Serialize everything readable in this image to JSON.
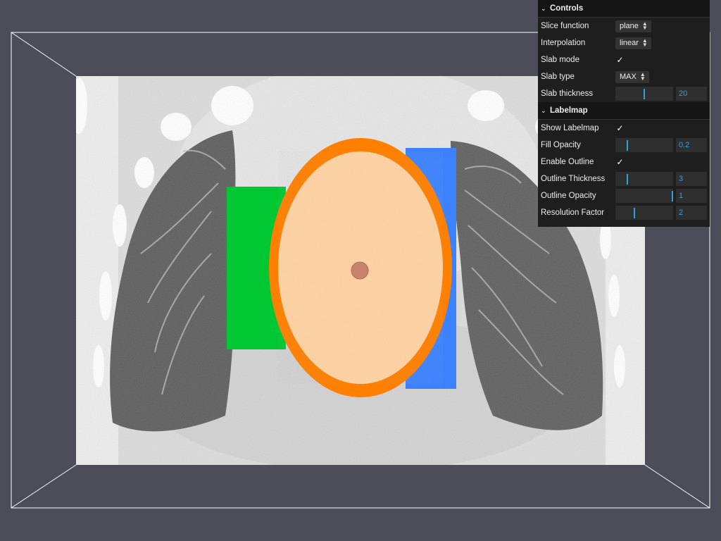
{
  "controls": {
    "title": "Controls",
    "slice_function": {
      "label": "Slice function",
      "value": "plane"
    },
    "interpolation": {
      "label": "Interpolation",
      "value": "linear"
    },
    "slab_mode": {
      "label": "Slab mode",
      "checked": true
    },
    "slab_type": {
      "label": "Slab type",
      "value": "MAX"
    },
    "slab_thickness": {
      "label": "Slab thickness",
      "value": "20",
      "fraction": 0.5
    }
  },
  "labelmap": {
    "title": "Labelmap",
    "show_labelmap": {
      "label": "Show Labelmap",
      "checked": true
    },
    "fill_opacity": {
      "label": "Fill Opacity",
      "value": "0.2",
      "fraction": 0.2
    },
    "enable_outline": {
      "label": "Enable Outline",
      "checked": true
    },
    "outline_thickness": {
      "label": "Outline Thickness",
      "value": "3",
      "fraction": 0.2
    },
    "outline_opacity": {
      "label": "Outline Opacity",
      "value": "1",
      "fraction": 1.0
    },
    "resolution_factor": {
      "label": "Resolution Factor",
      "value": "2",
      "fraction": 0.33
    }
  },
  "icons": {
    "chevron": "chevron-down-icon",
    "check": "checkmark-icon",
    "select_arrows": "up-down-arrows-icon"
  },
  "colors": {
    "viewport_bg": "#4d4d59",
    "panel_bg": "#1e1e1e",
    "accent": "#2fa1d6",
    "label_orange": "#ff7f00",
    "label_green": "#00c832",
    "label_blue": "#3c82ff",
    "label_fill": "#ffd9b0"
  }
}
